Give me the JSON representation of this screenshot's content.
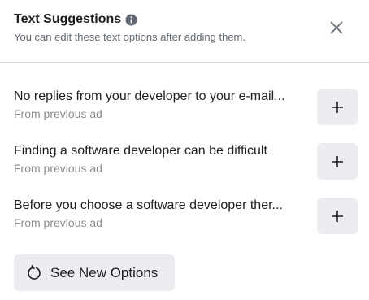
{
  "header": {
    "title": "Text Suggestions",
    "subtitle": "You can edit these text options after adding them.",
    "info_icon": "info-icon",
    "close_icon": "close-icon"
  },
  "suggestions": [
    {
      "text": "No replies from your developer to your e-mail...",
      "source": "From previous ad",
      "add_icon": "plus-icon"
    },
    {
      "text": "Finding a software developer can be difficult",
      "source": "From previous ad",
      "add_icon": "plus-icon"
    },
    {
      "text": "Before you choose a software developer ther...",
      "source": "From previous ad",
      "add_icon": "plus-icon"
    }
  ],
  "footer": {
    "see_new_label": "See New Options",
    "refresh_icon": "refresh-icon"
  },
  "colors": {
    "text_primary": "#1c1e21",
    "text_secondary": "#606770",
    "text_muted": "#8a8d91",
    "button_bg": "#ebedf0",
    "divider": "#dadde1"
  }
}
